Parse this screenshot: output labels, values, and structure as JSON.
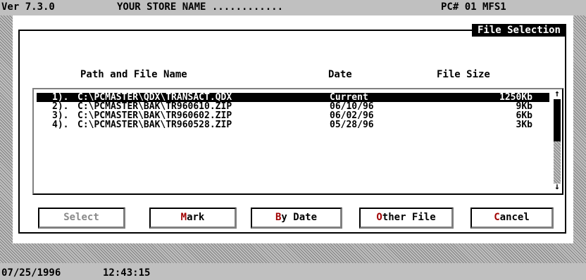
{
  "topbar": {
    "version": "Ver 7.3.0",
    "store": "YOUR STORE NAME ............",
    "pc": "PC# 01 MFS1"
  },
  "dialog": {
    "title": "File Selection",
    "headers": {
      "path": "Path and File Name",
      "date": "Date",
      "size": "File Size"
    },
    "files": [
      {
        "num": "1).",
        "path": "C:\\PCMASTER\\QDX\\TRANSACT.QDX",
        "date": "Current",
        "size": "1250Kb",
        "selected": true
      },
      {
        "num": "2).",
        "path": "C:\\PCMASTER\\BAK\\TR960610.ZIP",
        "date": "06/10/96",
        "size": "9Kb",
        "selected": false
      },
      {
        "num": "3).",
        "path": "C:\\PCMASTER\\BAK\\TR960602.ZIP",
        "date": "06/02/96",
        "size": "6Kb",
        "selected": false
      },
      {
        "num": "4).",
        "path": "C:\\PCMASTER\\BAK\\TR960528.ZIP",
        "date": "05/28/96",
        "size": "3Kb",
        "selected": false
      }
    ],
    "scroll": {
      "up_icon": "↑",
      "down_icon": "↓"
    },
    "buttons": {
      "select": "Select",
      "mark_hot": "M",
      "mark_rest": "ark",
      "bydate_hot": "B",
      "bydate_rest": "y Date",
      "other_hot": "O",
      "other_rest": "ther File",
      "cancel_hot": "C",
      "cancel_rest": "ancel"
    }
  },
  "statusbar": {
    "date": "07/25/1996",
    "time": "12:43:15"
  }
}
